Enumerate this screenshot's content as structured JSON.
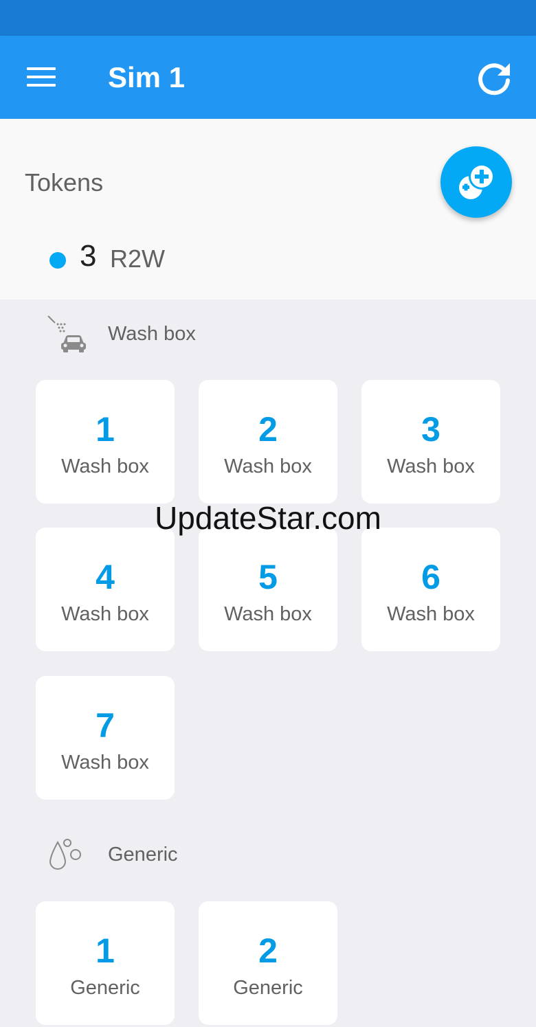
{
  "app_bar": {
    "title": "Sim 1",
    "menu_icon": "hamburger-menu-icon",
    "refresh_icon": "refresh-icon",
    "color": "#2196f3"
  },
  "tokens": {
    "title": "Tokens",
    "count": "3",
    "unit": "R2W",
    "fab_icon": "add-tokens-icon",
    "accent": "#03a9f4"
  },
  "sections": [
    {
      "label": "Wash box",
      "icon": "car-wash-icon",
      "cards": [
        {
          "number": "1",
          "label": "Wash box"
        },
        {
          "number": "2",
          "label": "Wash box"
        },
        {
          "number": "3",
          "label": "Wash box"
        },
        {
          "number": "4",
          "label": "Wash box"
        },
        {
          "number": "5",
          "label": "Wash box"
        },
        {
          "number": "6",
          "label": "Wash box"
        },
        {
          "number": "7",
          "label": "Wash box"
        }
      ]
    },
    {
      "label": "Generic",
      "icon": "water-drops-icon",
      "cards": [
        {
          "number": "1",
          "label": "Generic"
        },
        {
          "number": "2",
          "label": "Generic"
        }
      ]
    }
  ],
  "watermark": "UpdateStar.com"
}
